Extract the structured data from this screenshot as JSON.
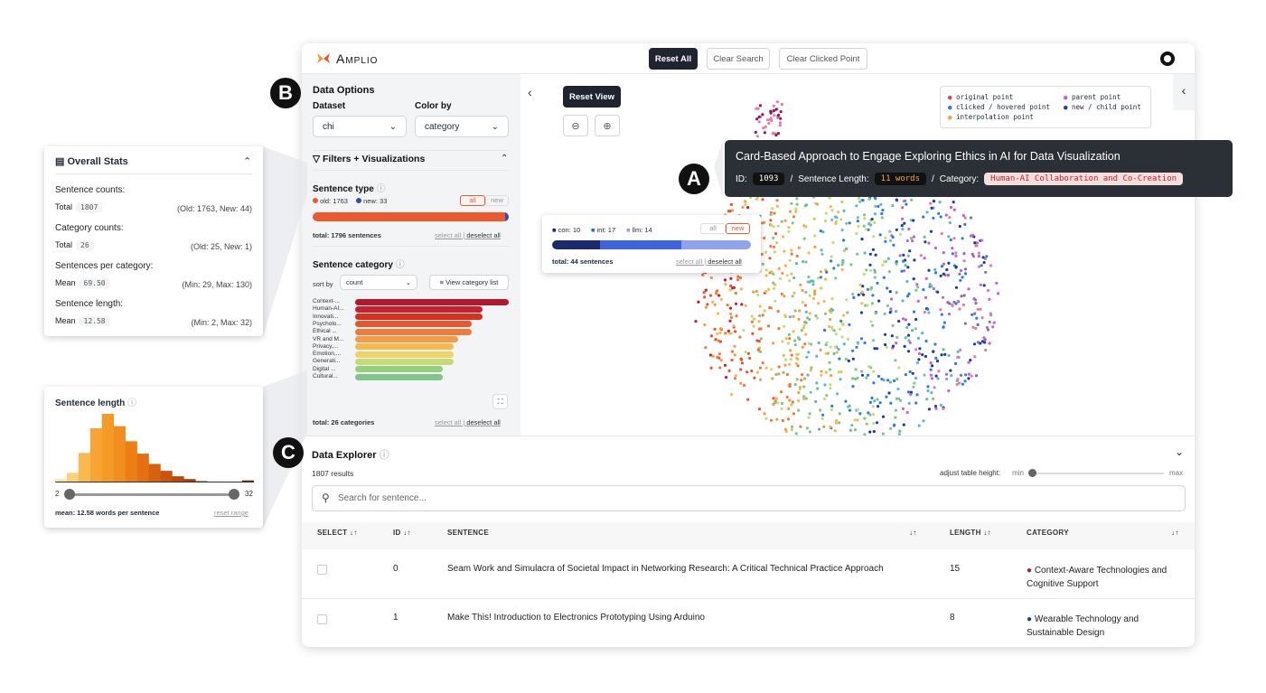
{
  "app": {
    "name": "Amplio",
    "reset_all": "Reset All",
    "clear_search": "Clear Search",
    "clear_clicked": "Clear Clicked Point"
  },
  "data_options": {
    "heading": "Data Options",
    "dataset_label": "Dataset",
    "dataset_value": "chi",
    "color_label": "Color by",
    "color_value": "category",
    "collapse": "‹"
  },
  "filters": {
    "heading": "Filters + Visualizations"
  },
  "sentence_type": {
    "heading": "Sentence type",
    "old": "old: 1763",
    "new": "new: 33",
    "all": "all",
    "new_btn": "new",
    "total": "total: 1796 sentences",
    "select_all": "select all",
    "deselect_all": "deselect all",
    "old_fraction": 0.98,
    "colors": {
      "old": "#ee5a30",
      "new": "#3949ab"
    }
  },
  "sentence_category": {
    "heading": "Sentence category",
    "sort_by": "sort by",
    "sort_value": "count",
    "view_list": "≡ View category list",
    "total": "total: 26 categories",
    "select_all": "select all",
    "deselect_all": "deselect all",
    "items": [
      {
        "label": "Context-...",
        "value": 1.0,
        "color": "#b2182b"
      },
      {
        "label": "Human-AI...",
        "value": 0.83,
        "color": "#c9202f"
      },
      {
        "label": "Innovati...",
        "value": 0.83,
        "color": "#d7301f"
      },
      {
        "label": "Psycholo...",
        "value": 0.76,
        "color": "#e8552f"
      },
      {
        "label": "Ethical ...",
        "value": 0.76,
        "color": "#f07a3a"
      },
      {
        "label": "VR and M...",
        "value": 0.67,
        "color": "#f39c45"
      },
      {
        "label": "Privacy,...",
        "value": 0.64,
        "color": "#f6b94f"
      },
      {
        "label": "Emotion,...",
        "value": 0.64,
        "color": "#ecd36a"
      },
      {
        "label": "Generati...",
        "value": 0.64,
        "color": "#c5da78"
      },
      {
        "label": "Digital ...",
        "value": 0.57,
        "color": "#95cf7a"
      },
      {
        "label": "Cultural...",
        "value": 0.57,
        "color": "#7fc58c"
      }
    ]
  },
  "plot": {
    "reset_view": "Reset View",
    "collapse_right": "‹",
    "legend": [
      "original point",
      "clicked / hovered point",
      "interpolation point",
      "parent point",
      "new / child point"
    ],
    "legend_colors": [
      "#d94848",
      "#2a7ee0",
      "#f2a43a",
      "#c062d6",
      "#1a3ea0"
    ]
  },
  "tooltip": {
    "title": "Card-Based Approach to Engage Exploring Ethics in AI for Data Visualization",
    "id_label": "ID:",
    "id": "1093",
    "sep1": "/",
    "len_label": "Sentence Length:",
    "len": "11 words",
    "sep2": "/",
    "cat_label": "Category:",
    "cat": "Human-AI Collaboration and Co-Creation"
  },
  "subtype": {
    "con": "con: 10",
    "int": "int: 17",
    "llm": "llm: 14",
    "all": "all",
    "new": "new",
    "total": "total: 44 sentences",
    "select_all": "select all",
    "deselect_all": "deselect all",
    "fractions": [
      0.24,
      0.41,
      0.35
    ],
    "colors": [
      "#1a2a6c",
      "#3f63d8",
      "#8fa3ea"
    ]
  },
  "overall": {
    "heading": "Overall Stats",
    "s_counts": "Sentence counts:",
    "total_label": "Total",
    "s_total": "1807",
    "s_detail": "(Old: 1763, New: 44)",
    "c_counts": "Category counts:",
    "c_total": "26",
    "c_detail": "(Old: 25, New: 1)",
    "spc": "Sentences per category:",
    "mean_label": "Mean",
    "spc_mean": "69.50",
    "spc_detail": "(Min: 29, Max: 130)",
    "slen": "Sentence length:",
    "slen_mean": "12.58",
    "slen_detail": "(Min: 2, Max: 32)"
  },
  "histogram": {
    "heading": "Sentence length",
    "min": "2",
    "max": "32",
    "mean_text": "mean: 12.58 words per sentence",
    "reset": "reset range",
    "bins": [
      0.05,
      0.14,
      0.43,
      0.79,
      1.0,
      0.82,
      0.6,
      0.42,
      0.27,
      0.17,
      0.09,
      0.05,
      0.02,
      0.0,
      0.0,
      0.0,
      0.03
    ],
    "colors": [
      "#fde4a2",
      "#fdd07a",
      "#fbb84f",
      "#f8a434",
      "#f59a26",
      "#f28d1f",
      "#ec7e16",
      "#e37012",
      "#d8610f",
      "#cc540d",
      "#bf470b",
      "#a73e0a",
      "#8e3508",
      "#7a2e06",
      "#7a2e06",
      "#7a2e06",
      "#6d2905"
    ]
  },
  "explorer": {
    "heading": "Data Explorer",
    "results": "1807 results",
    "adjust": "adjust table height:",
    "min": "min",
    "max": "max",
    "search_placeholder": "Search for sentence...",
    "cols": {
      "select": "SELECT",
      "id": "ID",
      "sentence": "SENTENCE",
      "length": "LENGTH",
      "category": "CATEGORY"
    },
    "sort_icon": "↓↑",
    "rows": [
      {
        "id": "0",
        "sentence": "Seam Work and Simulacra of Societal Impact in Networking Research: A Critical Technical Practice Approach",
        "length": "15",
        "cat1": "Context-Aware Technologies and",
        "cat2": "Cognitive Support",
        "color": "#b2182b"
      },
      {
        "id": "1",
        "sentence": "Make This! Introduction to Electronics Prototyping Using Arduino",
        "length": "8",
        "cat1": "Wearable Technology and",
        "cat2": "Sustainable Design",
        "color": "#1a3ea0"
      }
    ]
  },
  "badges": {
    "a": "A",
    "b": "B",
    "c": "C"
  }
}
